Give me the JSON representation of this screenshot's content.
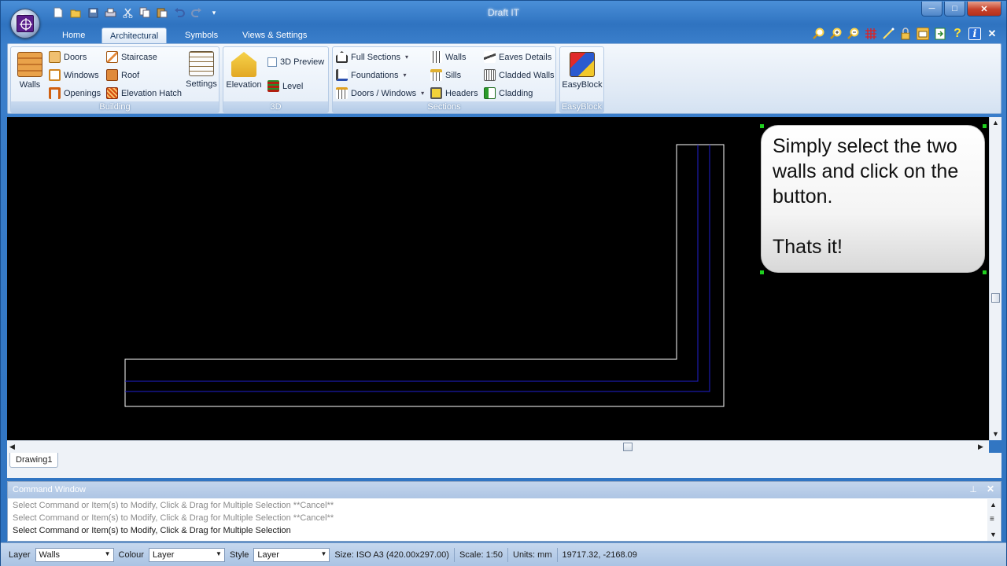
{
  "window": {
    "title": "Draft IT",
    "minimize": "─",
    "maximize": "□",
    "close": "✕"
  },
  "qat_icons": [
    "new-document-icon",
    "open-folder-icon",
    "save-icon",
    "print-icon",
    "cut-icon",
    "copy-icon",
    "paste-icon",
    "undo-icon",
    "redo-icon",
    "customize-dropdown-icon"
  ],
  "ribbon_tabs": [
    {
      "label": "Home",
      "active": false
    },
    {
      "label": "Architectural",
      "active": true
    },
    {
      "label": "Symbols",
      "active": false
    },
    {
      "label": "Views & Settings",
      "active": false
    }
  ],
  "ribbon": {
    "building": {
      "label": "Building",
      "walls": "Walls",
      "doors": "Doors",
      "windows": "Windows",
      "openings": "Openings",
      "staircase": "Staircase",
      "roof": "Roof",
      "elevation_hatch": "Elevation Hatch",
      "settings": "Settings"
    },
    "threed": {
      "label": "3D",
      "elevation": "Elevation",
      "preview": "3D Preview",
      "level": "Level"
    },
    "sections": {
      "label": "Sections",
      "full_sections": "Full Sections",
      "foundations": "Foundations",
      "doors_windows": "Doors / Windows",
      "walls": "Walls",
      "sills": "Sills",
      "headers": "Headers",
      "eaves_details": "Eaves Details",
      "cladded_walls": "Cladded Walls",
      "cladding": "Cladding"
    },
    "easyblock": {
      "label": "EasyBlock",
      "button": "EasyBlock"
    }
  },
  "callout": {
    "text": "Simply select the two walls and click on the button.\n\nThats it!"
  },
  "doc_tabs": [
    "Drawing1"
  ],
  "command_window": {
    "title": "Command Window",
    "lines": [
      {
        "text": "Select Command or Item(s) to Modify, Click & Drag for Multiple Selection  **Cancel**",
        "dim": true
      },
      {
        "text": "Select Command or Item(s) to Modify, Click & Drag for Multiple Selection  **Cancel**",
        "dim": true
      },
      {
        "text": "Select Command or Item(s) to Modify, Click & Drag for Multiple Selection",
        "dim": false
      }
    ]
  },
  "status": {
    "layer_label": "Layer",
    "layer_value": "Walls",
    "colour_label": "Colour",
    "colour_value": "Layer",
    "style_label": "Style",
    "style_value": "Layer",
    "size": "Size: ISO A3 (420.00x297.00)",
    "scale": "Scale: 1:50",
    "units": "Units: mm",
    "coords": "19717.32, -2168.09"
  },
  "colors": {
    "canvas": "#000000",
    "wall_outline": "#ffffff",
    "wall_inner": "#2020d0",
    "grip": "#1fd01f",
    "title_bar": "#2f73c0"
  }
}
